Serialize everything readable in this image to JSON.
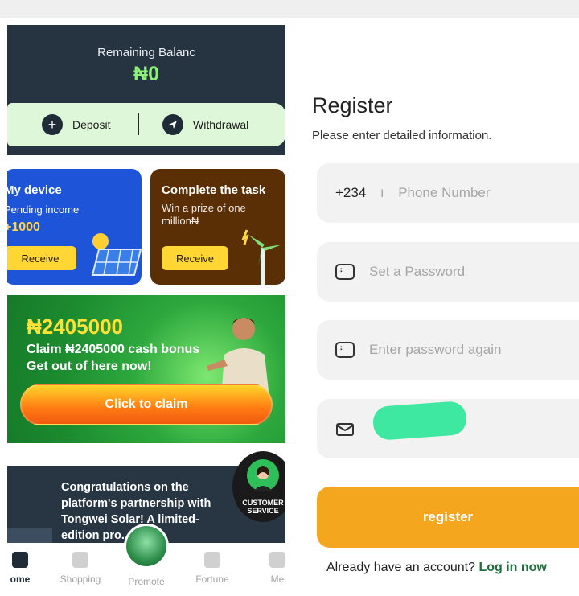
{
  "balance": {
    "label": "Remaining Balanc",
    "value": "₦0",
    "deposit_label": "Deposit",
    "withdrawal_label": "Withdrawal"
  },
  "cards": {
    "device": {
      "title": "My device",
      "subtitle": "Pending income",
      "amount": "+1000",
      "button": "Receive"
    },
    "task": {
      "title": "Complete the task",
      "subtitle": "Win a prize of one million₦",
      "button": "Receive"
    }
  },
  "promo": {
    "amount": "₦2405000",
    "text": "Claim ₦2405000 cash bonus Get out of here now!",
    "button": "Click to claim"
  },
  "news": {
    "text": "Congratulations on the platform's partnership with Tongwei Solar! A limited-edition pro... now"
  },
  "customer_service": {
    "label": "CUSTOMER SERVICE"
  },
  "tabbar": {
    "items": [
      {
        "label": "ome",
        "active": true
      },
      {
        "label": "Shopping",
        "active": false
      },
      {
        "label": "Promote",
        "active": false
      },
      {
        "label": "Fortune",
        "active": false
      },
      {
        "label": "Me",
        "active": false
      }
    ]
  },
  "register": {
    "title": "Register",
    "subtitle": "Please enter detailed information.",
    "country_code": "+234",
    "phone_placeholder": "Phone Number",
    "password_placeholder": "Set a Password",
    "password_again_placeholder": "Enter password again",
    "button": "register",
    "login_prompt": "Already have an account?",
    "login_link": "Log in now"
  },
  "colors": {
    "accent_orange": "#f4a61f",
    "balance_green": "#8ef07a",
    "dark_navy": "#263340",
    "link_green": "#1f6f3c"
  }
}
